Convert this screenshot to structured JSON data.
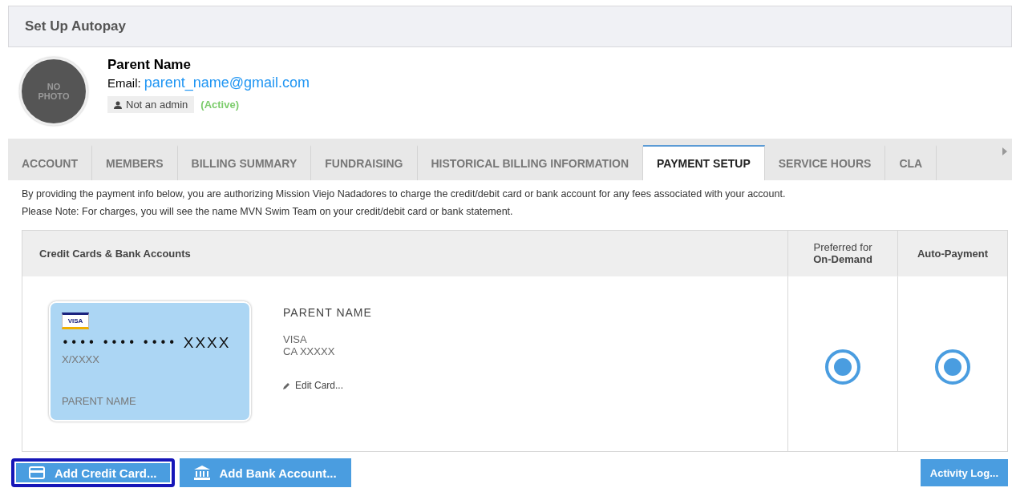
{
  "header": {
    "title": "Set Up Autopay"
  },
  "profile": {
    "avatar_text": [
      "NO",
      "PHOTO"
    ],
    "name": "Parent Name",
    "email_label": "Email:",
    "email": "parent_name@gmail.com",
    "role": "Not an admin",
    "status": "(Active)"
  },
  "tabs": [
    {
      "label": "ACCOUNT",
      "selected": false
    },
    {
      "label": "MEMBERS",
      "selected": false
    },
    {
      "label": "BILLING SUMMARY",
      "selected": false
    },
    {
      "label": "FUNDRAISING",
      "selected": false
    },
    {
      "label": "HISTORICAL BILLING INFORMATION",
      "selected": false
    },
    {
      "label": "PAYMENT SETUP",
      "selected": true
    },
    {
      "label": "SERVICE HOURS",
      "selected": false
    },
    {
      "label": "CLA",
      "selected": false
    }
  ],
  "notices": [
    "By providing the payment info below, you are authorizing Mission Viejo Nadadores to charge the credit/debit card or bank account for any fees associated with your account.",
    "Please Note: For charges, you will see the name MVN Swim Team on your credit/debit card or bank statement."
  ],
  "table": {
    "columns": [
      "Credit Cards & Bank Accounts",
      [
        "Preferred for",
        "On-Demand"
      ],
      "Auto-Payment"
    ],
    "rows": [
      {
        "card": {
          "brand_logo": "VISA",
          "dots": "•••• •••• ••••",
          "last4": "XXXX",
          "expiry": "X/XXXX",
          "holder": "PARENT NAME"
        },
        "owner": "PARENT NAME",
        "brand": "VISA",
        "detail": "CA XXXXX",
        "edit": "Edit Card...",
        "preferred": true,
        "autopay": true
      }
    ]
  },
  "buttons": [
    {
      "kind": "card",
      "label": "Add Credit Card...",
      "highlighted": true
    },
    {
      "kind": "bank",
      "label": "Add Bank Account...",
      "highlighted": false
    },
    {
      "kind": "plain",
      "label": "Activity Log...",
      "highlighted": false
    }
  ]
}
